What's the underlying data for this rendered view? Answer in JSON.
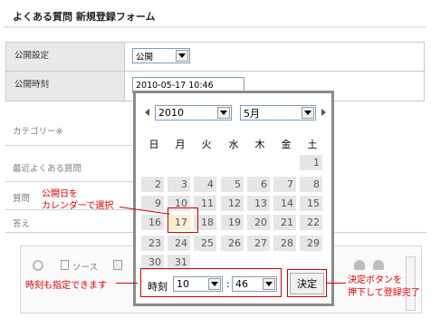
{
  "header": {
    "title": "よくある質問 新規登録フォーム"
  },
  "form": {
    "publish_label": "公開設定",
    "publish_value": "公開",
    "publish_time_label": "公開時刻",
    "publish_time_value": "2010-05-17 10:46"
  },
  "background_form": {
    "category_label": "カテゴリー※",
    "recent_faq_label": "最近よくある質問",
    "question_label": "質問",
    "answer_label": "答え",
    "source_label": "ソース"
  },
  "calendar": {
    "year": "2010",
    "month": "5月",
    "weekdays": [
      "日",
      "月",
      "火",
      "水",
      "木",
      "金",
      "土"
    ],
    "weeks": [
      [
        "",
        "",
        "",
        "",
        "",
        "",
        "1"
      ],
      [
        "2",
        "3",
        "4",
        "5",
        "6",
        "7",
        "8"
      ],
      [
        "9",
        "10",
        "11",
        "12",
        "13",
        "14",
        "15"
      ],
      [
        "16",
        "17",
        "18",
        "19",
        "20",
        "21",
        "22"
      ],
      [
        "23",
        "24",
        "25",
        "26",
        "27",
        "28",
        "29"
      ],
      [
        "30",
        "31",
        "",
        "",
        "",
        "",
        ""
      ]
    ],
    "selected_day": "17",
    "time_label": "時刻",
    "hour": "10",
    "minute": "46",
    "time_separator": ":",
    "ok_label": "決定"
  },
  "annotations": {
    "pick_date_line1": "公開日を",
    "pick_date_line2": "カレンダーで選択",
    "set_time": "時刻も指定できます",
    "confirm_line1": "決定ボタンを",
    "confirm_line2": "押下して登録完了"
  },
  "colors": {
    "accent_red": "#e40000",
    "selected_day_bg": "#fbeed2"
  }
}
